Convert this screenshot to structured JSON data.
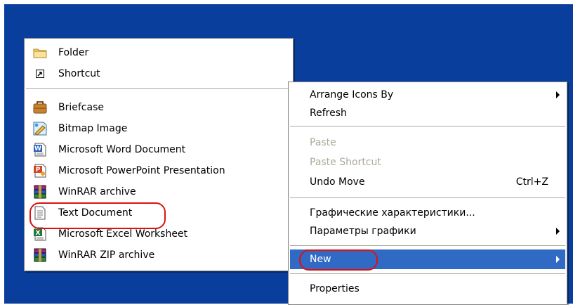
{
  "new_submenu": {
    "items": [
      {
        "label": "Folder",
        "icon": "folder-icon"
      },
      {
        "label": "Shortcut",
        "icon": "shortcut-icon"
      },
      {
        "label": "Briefcase",
        "icon": "briefcase-icon"
      },
      {
        "label": "Bitmap Image",
        "icon": "bitmap-image-icon"
      },
      {
        "label": "Microsoft Word Document",
        "icon": "word-document-icon"
      },
      {
        "label": "Microsoft PowerPoint Presentation",
        "icon": "powerpoint-icon"
      },
      {
        "label": "WinRAR archive",
        "icon": "winrar-archive-icon"
      },
      {
        "label": "Text Document",
        "icon": "text-document-icon",
        "highlighted": true
      },
      {
        "label": "Microsoft Excel Worksheet",
        "icon": "excel-worksheet-icon"
      },
      {
        "label": "WinRAR ZIP archive",
        "icon": "winrar-zip-icon"
      }
    ]
  },
  "context_menu": {
    "items": [
      {
        "label": "Arrange Icons By",
        "has_submenu": true
      },
      {
        "label": "Refresh"
      },
      {
        "label": "Paste",
        "disabled": true
      },
      {
        "label": "Paste Shortcut",
        "disabled": true
      },
      {
        "label": "Undo Move",
        "shortcut": "Ctrl+Z"
      },
      {
        "label": "Графические характеристики..."
      },
      {
        "label": "Параметры графики",
        "has_submenu": true
      },
      {
        "label": "New",
        "has_submenu": true,
        "selected": true,
        "highlighted": true
      },
      {
        "label": "Properties"
      }
    ]
  },
  "colors": {
    "desktop_background": "#0a3e9c",
    "selection": "#316ac5",
    "highlight_ring": "#e01010",
    "disabled_text": "#aca899"
  }
}
